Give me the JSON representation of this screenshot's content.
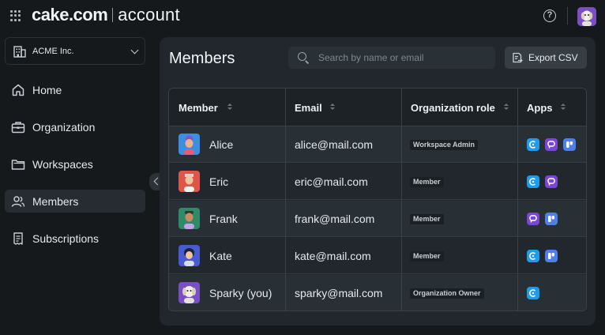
{
  "brand": {
    "name_bold": "cake.com",
    "name_light": "account"
  },
  "org_select": {
    "name": "ACME Inc."
  },
  "nav": {
    "items": [
      {
        "label": "Home",
        "icon": "home-icon"
      },
      {
        "label": "Organization",
        "icon": "briefcase-icon"
      },
      {
        "label": "Workspaces",
        "icon": "folder-icon"
      },
      {
        "label": "Members",
        "icon": "users-icon",
        "active": true
      },
      {
        "label": "Subscriptions",
        "icon": "receipt-icon"
      }
    ]
  },
  "main": {
    "title": "Members",
    "search": {
      "placeholder": "Search by name or email",
      "value": ""
    },
    "export_label": "Export CSV"
  },
  "table": {
    "columns": [
      "Member",
      "Email",
      "Organization role",
      "Apps"
    ],
    "rows": [
      {
        "name": "Alice",
        "email": "alice@mail.com",
        "role": "Workspace Admin",
        "apps": [
          "clockify",
          "pumble",
          "plaky"
        ]
      },
      {
        "name": "Eric",
        "email": "eric@mail.com",
        "role": "Member",
        "apps": [
          "clockify",
          "pumble"
        ]
      },
      {
        "name": "Frank",
        "email": "frank@mail.com",
        "role": "Member",
        "apps": [
          "pumble",
          "plaky"
        ]
      },
      {
        "name": "Kate",
        "email": "kate@mail.com",
        "role": "Member",
        "apps": [
          "clockify",
          "plaky"
        ]
      },
      {
        "name": "Sparky (you)",
        "email": "sparky@mail.com",
        "role": "Organization Owner",
        "apps": [
          "clockify"
        ]
      }
    ]
  },
  "colors": {
    "background": "#15191c",
    "panel": "#21272c",
    "clockify": "#1e9bea",
    "pumble": "#7b45d6",
    "plaky": "#4f7fe8"
  }
}
